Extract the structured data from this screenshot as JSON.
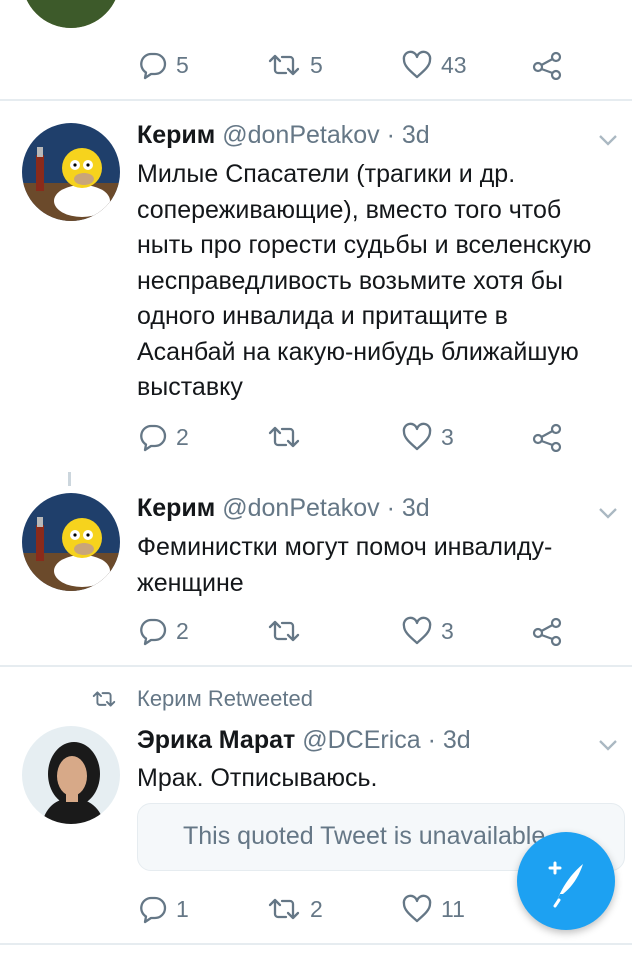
{
  "tweets": [
    {
      "stats": {
        "replies": "5",
        "retweets": "5",
        "likes": "43"
      }
    },
    {
      "name": "Керим",
      "handle": "@donPetakov",
      "time": "3d",
      "text": "Милые Спасатели (трагики и др. сопереживающие), вместо того чтоб ныть про горести судьбы и вселенскую несправедливость возьмите хотя бы одного инвалида и притащите в Асанбай на какую-нибудь ближайшую выставку",
      "stats": {
        "replies": "2",
        "retweets": "",
        "likes": "3"
      }
    },
    {
      "name": "Керим",
      "handle": "@donPetakov",
      "time": "3d",
      "text": "Феминистки могут помоч инвалиду-женщине",
      "stats": {
        "replies": "2",
        "retweets": "",
        "likes": "3"
      }
    },
    {
      "retweeted_by": "Керим Retweeted",
      "name": "Эрика Марат",
      "handle": "@DCErica",
      "time": "3d",
      "text": "Мрак. Отписываюсь.",
      "quote": "This quoted Tweet is unavailable.",
      "stats": {
        "replies": "1",
        "retweets": "2",
        "likes": "11"
      }
    }
  ],
  "icons": {
    "reply": "reply-icon",
    "retweet": "retweet-icon",
    "like": "heart-icon",
    "share": "share-icon",
    "compose": "compose-tweet-icon",
    "caret": "chevron-down-icon"
  },
  "colors": {
    "accent": "#1da1f2",
    "muted": "#657786",
    "text": "#14171a",
    "divider": "#e6ecf0"
  }
}
